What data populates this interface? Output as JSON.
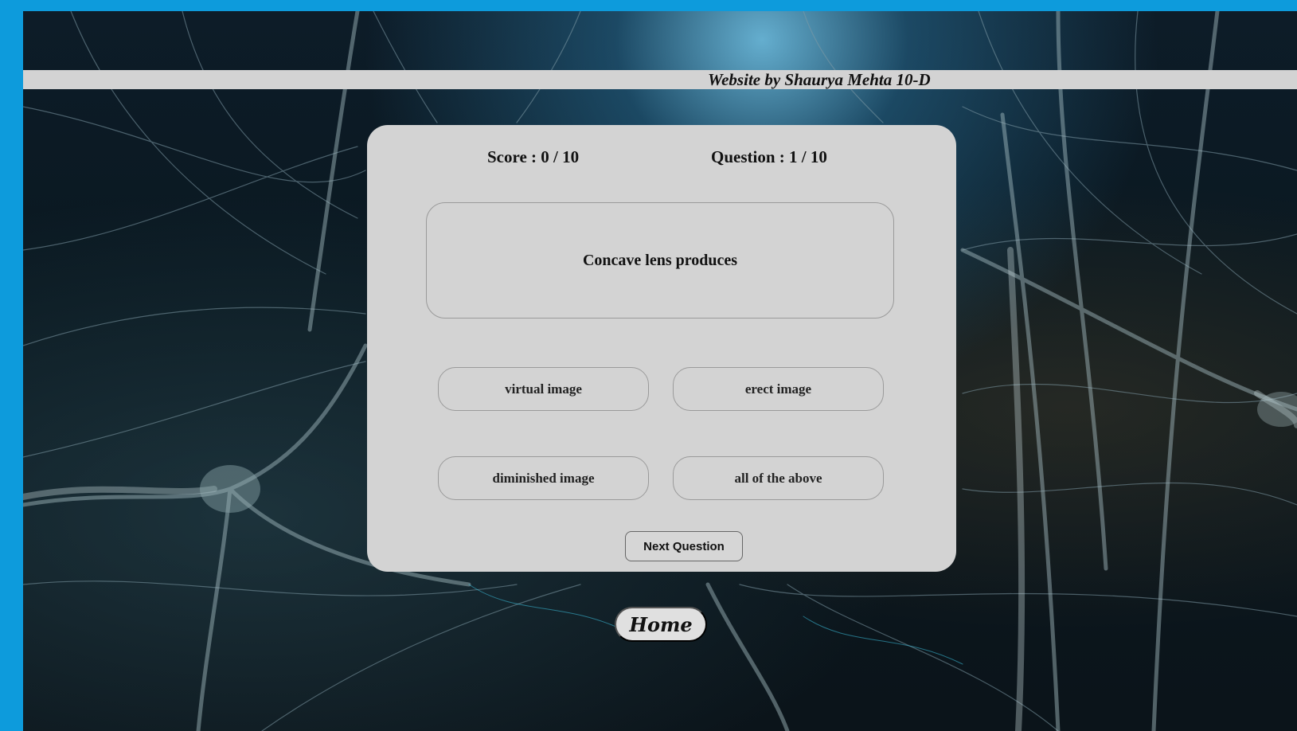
{
  "credit": {
    "text": "Website by Shaurya Mehta 10-D"
  },
  "quiz": {
    "score_text": "Score : 0 / 10",
    "question_counter_text": "Question : 1 / 10",
    "question": "Concave lens produces",
    "options": [
      "virtual image",
      "erect image",
      "diminished image",
      "all of the above"
    ],
    "next_label": "Next Question"
  },
  "nav": {
    "home_label": "Home"
  },
  "colors": {
    "frame": "#0d9bdc",
    "panel": "#d3d3d3",
    "background_dark": "#0b141a"
  },
  "background": {
    "description_icon": "neuron-network-image"
  }
}
